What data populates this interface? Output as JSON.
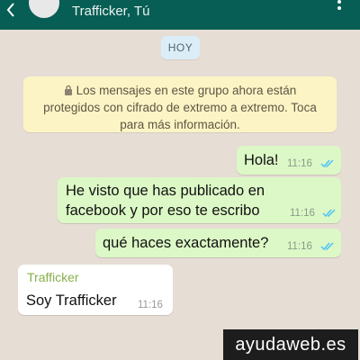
{
  "header": {
    "subtitle": "Trafficker, Tú",
    "back_icon": "arrow-left-icon",
    "menu_icon": "more-vert-icon"
  },
  "date_chip": "HOY",
  "notice": {
    "line1": "Los mensajes en este grupo ahora están",
    "line2": "protegidos con cifrado de extremo a extremo. Toca",
    "line3": "para más información.",
    "icon": "lock-icon"
  },
  "messages": [
    {
      "direction": "out",
      "text": "Hola!",
      "time": "11:16",
      "status": "read"
    },
    {
      "direction": "out",
      "text": "He visto que has publicado en\nfacebook y por eso te escribo",
      "time": "11:16",
      "status": "read"
    },
    {
      "direction": "out",
      "text": "qué haces exactamente?",
      "time": "11:16",
      "status": "read"
    },
    {
      "direction": "in",
      "sender": "Trafficker",
      "text": "Soy Trafficker",
      "time": "11:16"
    }
  ],
  "watermark": "ayudaweb.es",
  "colors": {
    "header": "#075e54",
    "outgoing_bubble": "#dcf8c6",
    "incoming_bubble": "#ffffff",
    "read_ticks": "#4fc3f7",
    "sender_name": "#88b04b"
  }
}
